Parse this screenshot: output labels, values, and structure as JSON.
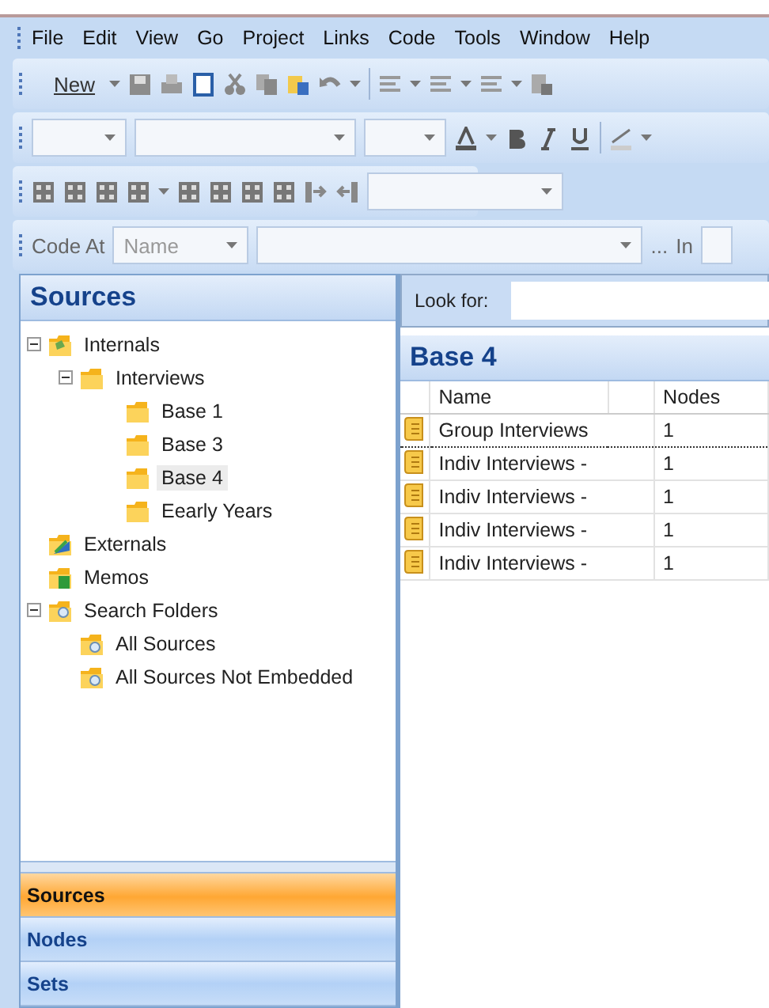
{
  "menu": [
    "File",
    "Edit",
    "View",
    "Go",
    "Project",
    "Links",
    "Code",
    "Tools",
    "Window",
    "Help"
  ],
  "toolbar": {
    "new_button": "New"
  },
  "code_bar": {
    "label": "Code At",
    "name_field": {
      "placeholder": "Name"
    },
    "ellipsis": "...",
    "in_label": "In"
  },
  "navigation": {
    "title": "Sources",
    "tree": [
      {
        "label": "Internals",
        "kind": "internals",
        "expanded": true,
        "selected": false,
        "children": [
          {
            "label": "Interviews",
            "kind": "folder",
            "expanded": true,
            "selected": false,
            "children": [
              {
                "label": "Base 1",
                "kind": "folder",
                "selected": false
              },
              {
                "label": "Base 3",
                "kind": "folder",
                "selected": false
              },
              {
                "label": "Base 4",
                "kind": "folder",
                "selected": true
              },
              {
                "label": "Eearly Years",
                "kind": "folder",
                "selected": false
              }
            ]
          }
        ]
      },
      {
        "label": "Externals",
        "kind": "externals",
        "selected": false
      },
      {
        "label": "Memos",
        "kind": "memos",
        "selected": false
      },
      {
        "label": "Search Folders",
        "kind": "search-folders",
        "expanded": true,
        "selected": false,
        "children": [
          {
            "label": "All Sources",
            "kind": "search",
            "selected": false
          },
          {
            "label": "All Sources Not Embedded",
            "kind": "search",
            "selected": false
          }
        ]
      }
    ],
    "buttons": [
      {
        "label": "Sources",
        "selected": true
      },
      {
        "label": "Nodes",
        "selected": false
      },
      {
        "label": "Sets",
        "selected": false
      }
    ]
  },
  "content": {
    "look_for": {
      "label": "Look for:"
    },
    "title": "Base 4",
    "columns": [
      "Name",
      "Nodes"
    ],
    "rows": [
      {
        "name": "Group Interviews",
        "nodes": "1",
        "selected": true
      },
      {
        "name": "Indiv Interviews -",
        "nodes": "1",
        "selected": false
      },
      {
        "name": "Indiv Interviews -",
        "nodes": "1",
        "selected": false
      },
      {
        "name": "Indiv Interviews -",
        "nodes": "1",
        "selected": false
      },
      {
        "name": "Indiv Interviews -",
        "nodes": "1",
        "selected": false
      }
    ]
  }
}
